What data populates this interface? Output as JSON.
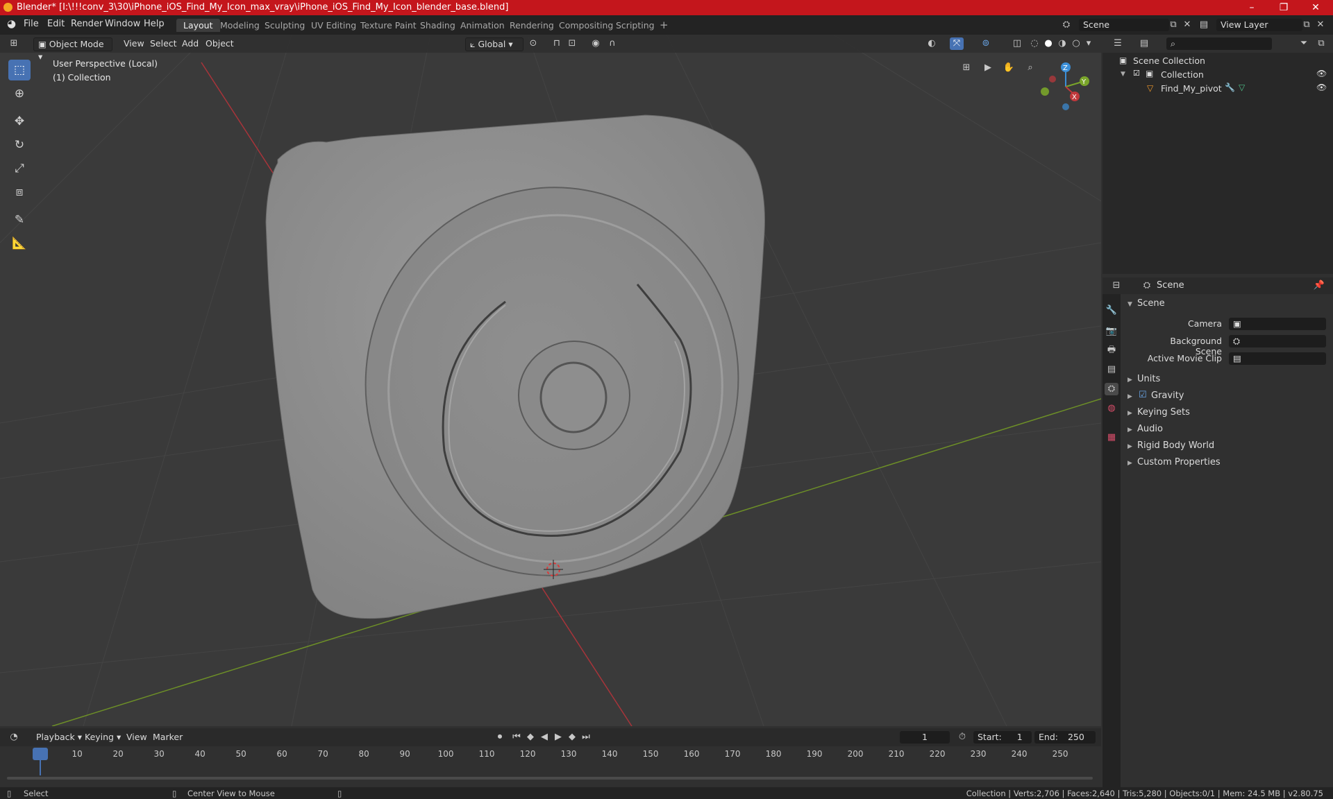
{
  "window": {
    "title": "Blender* [I:\\!!!conv_3\\30\\iPhone_iOS_Find_My_Icon_max_vray\\iPhone_iOS_Find_My_Icon_blender_base.blend]",
    "minimize": "–",
    "maximize": "❐",
    "close": "✕"
  },
  "menubar": {
    "items": [
      "File",
      "Edit",
      "Render",
      "Window",
      "Help"
    ],
    "workspaces": [
      "Layout",
      "Modeling",
      "Sculpting",
      "UV Editing",
      "Texture Paint",
      "Shading",
      "Animation",
      "Rendering",
      "Compositing",
      "Scripting"
    ],
    "add_workspace": "+",
    "scene": "Scene",
    "view_layer": "View Layer"
  },
  "viewport_header": {
    "mode": "Object Mode",
    "menus": [
      "View",
      "Select",
      "Add",
      "Object"
    ],
    "orientation": "Global"
  },
  "viewport": {
    "perspective": "User Perspective (Local)",
    "collection": "(1) Collection",
    "gizmo": {
      "z": "Z",
      "y": "Y",
      "x": "X"
    }
  },
  "outliner": {
    "scene_collection": "Scene Collection",
    "collection": "Collection",
    "object": "Find_My_pivot",
    "search_placeholder": ""
  },
  "properties": {
    "breadcrumb": "Scene",
    "panel": "Scene",
    "camera_label": "Camera",
    "background_scene_label": "Background Scene",
    "active_movie_clip_label": "Active Movie Clip",
    "sections": [
      "Units",
      "Gravity",
      "Keying Sets",
      "Audio",
      "Rigid Body World",
      "Custom Properties"
    ]
  },
  "timeline": {
    "menus": [
      "Playback",
      "Keying",
      "View",
      "Marker"
    ],
    "current_frame": "1",
    "start_label": "Start:",
    "start": "1",
    "end_label": "End:",
    "end": "250",
    "ticks": [
      "1",
      "10",
      "20",
      "30",
      "40",
      "50",
      "60",
      "70",
      "80",
      "90",
      "100",
      "110",
      "120",
      "130",
      "140",
      "150",
      "160",
      "170",
      "180",
      "190",
      "200",
      "210",
      "220",
      "230",
      "240",
      "250"
    ]
  },
  "statusbar": {
    "select": "Select",
    "center_view": "Center View to Mouse",
    "stats": "Collection | Verts:2,706 | Faces:2,640 | Tris:5,280 | Objects:0/1 | Mem: 24.5 MB | v2.80.75"
  },
  "colors": {
    "accent": "#4772b3",
    "titlebar": "#c4161c",
    "x_axis": "#c0383c",
    "y_axis": "#7aa52a",
    "z_axis": "#3b8fd8"
  }
}
